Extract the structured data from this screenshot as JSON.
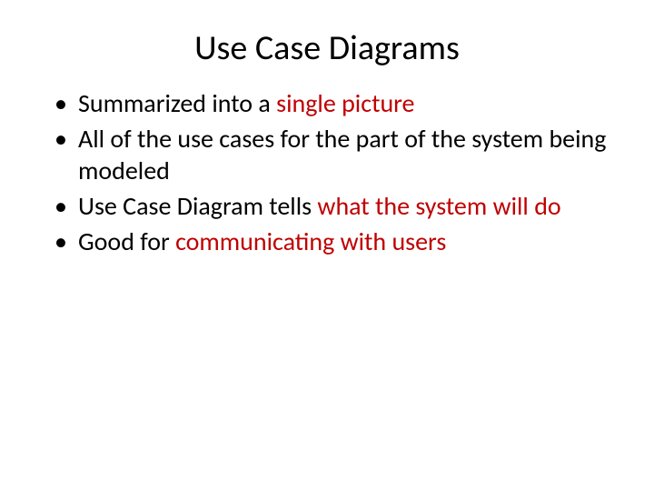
{
  "title": "Use Case Diagrams",
  "bullets": [
    {
      "pre": "Summarized into a ",
      "em": "single picture",
      "post": ""
    },
    {
      "pre": "All of the use cases for the part of the system being modeled",
      "em": "",
      "post": ""
    },
    {
      "pre": "Use Case Diagram tells ",
      "em": "what the system will do",
      "post": ""
    },
    {
      "pre": "Good for ",
      "em": "communicating with users",
      "post": ""
    }
  ]
}
